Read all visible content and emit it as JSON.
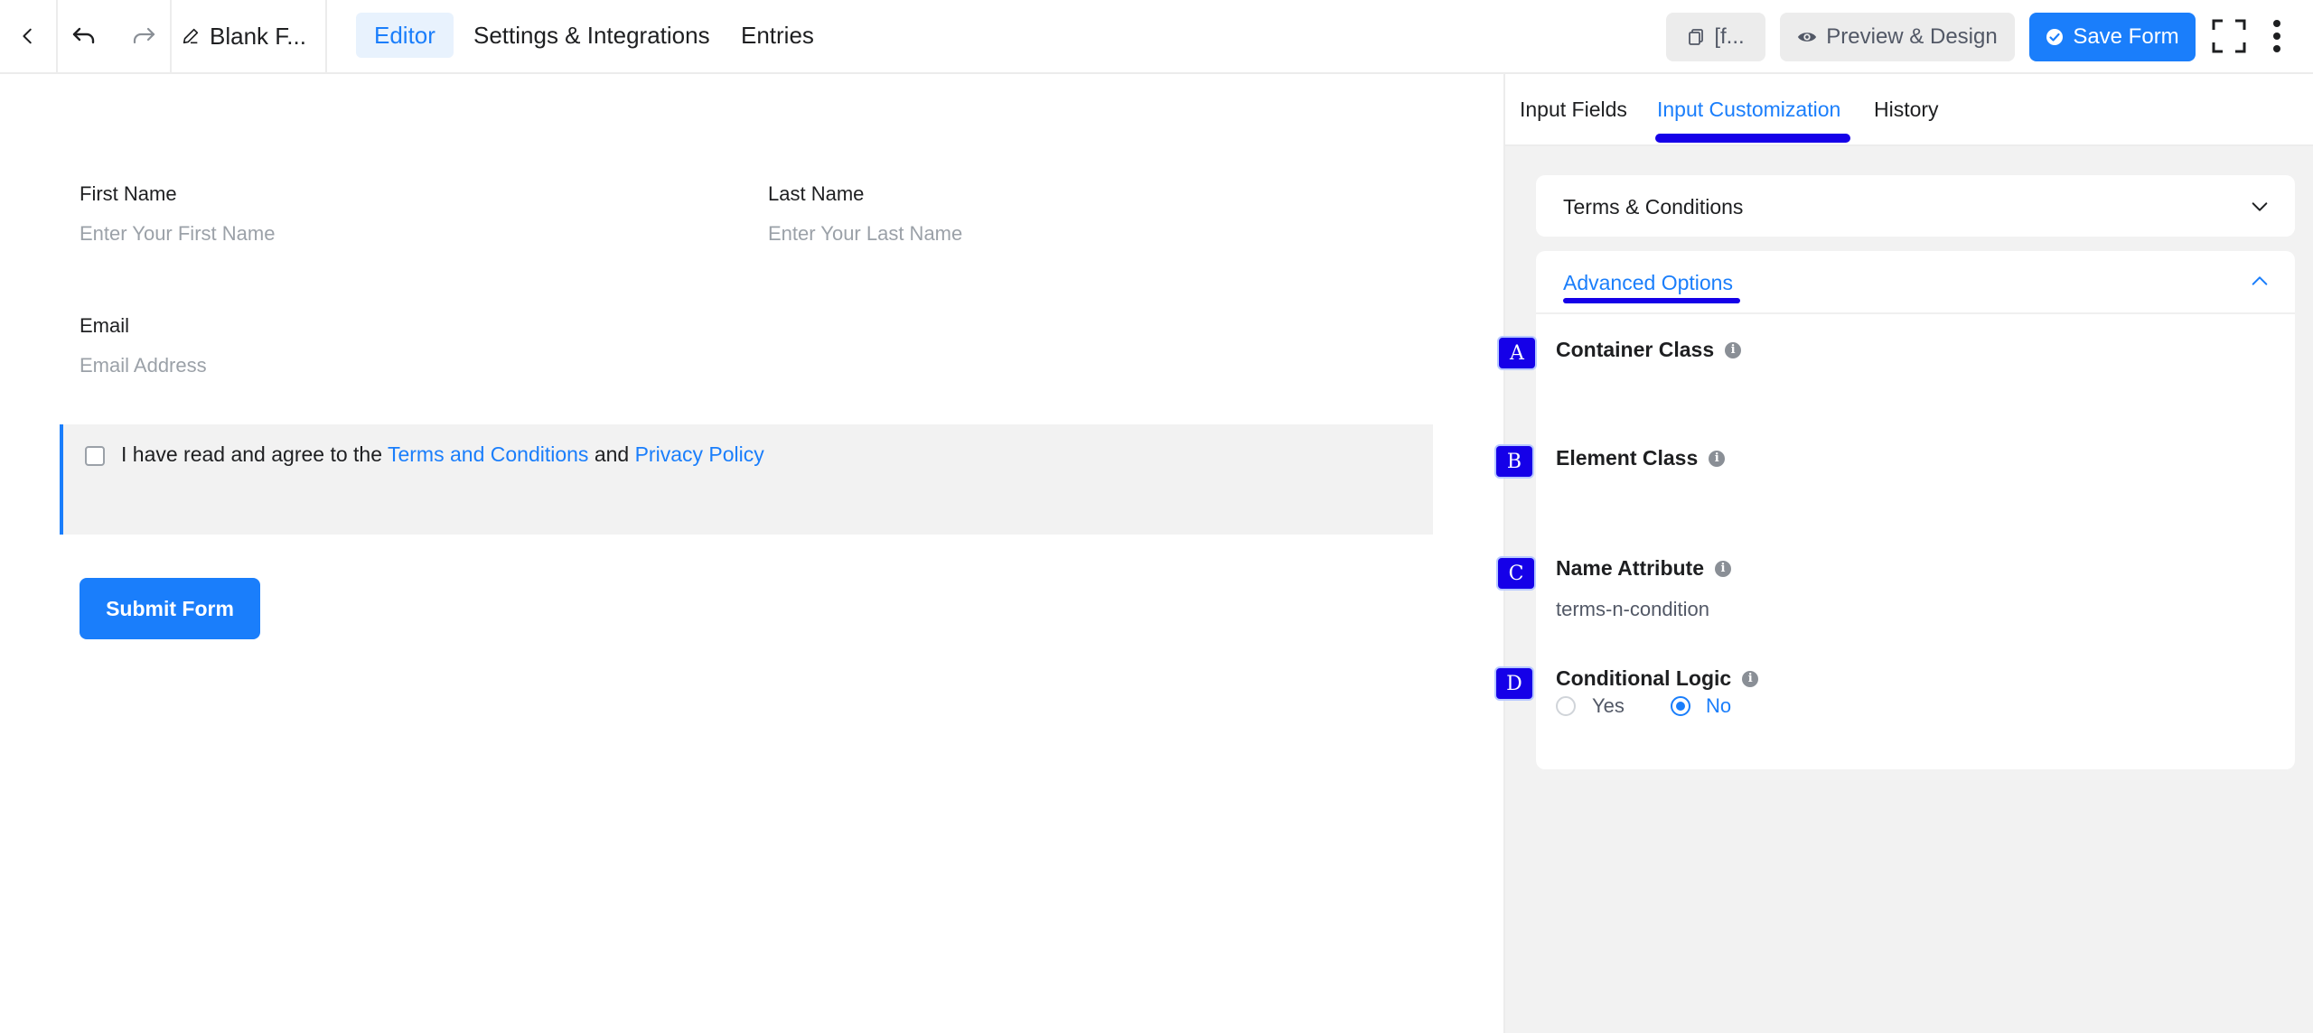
{
  "topbar": {
    "title": "Blank F...",
    "tabs": [
      "Editor",
      "Settings & Integrations",
      "Entries"
    ],
    "shortcode_label": "[f...",
    "preview_label": "Preview & Design",
    "save_label": "Save Form"
  },
  "form": {
    "first_name_label": "First Name",
    "first_name_placeholder": "Enter Your First Name",
    "last_name_label": "Last Name",
    "last_name_placeholder": "Enter Your Last Name",
    "email_label": "Email",
    "email_placeholder": "Email Address",
    "terms_prefix": "I have read and agree to the",
    "terms_link": "Terms and Conditions",
    "terms_and": "and",
    "privacy_link": "Privacy Policy",
    "submit_label": "Submit Form"
  },
  "sidebar": {
    "tabs": [
      "Input Fields",
      "Input Customization",
      "History"
    ],
    "active_tab": "Input Customization",
    "terms_section": "Terms & Conditions",
    "advanced_section": "Advanced Options",
    "options": {
      "container_class": "Container Class",
      "element_class": "Element Class",
      "name_attribute": "Name Attribute",
      "name_attribute_value": "terms-n-condition",
      "conditional_logic": "Conditional Logic",
      "yes": "Yes",
      "no": "No",
      "conditional_selected": "No"
    },
    "markers": [
      "A",
      "B",
      "C",
      "D"
    ]
  },
  "colors": {
    "accent": "#1a7efb",
    "marker": "#1500e8",
    "panel_bg": "#f2f2f2"
  }
}
